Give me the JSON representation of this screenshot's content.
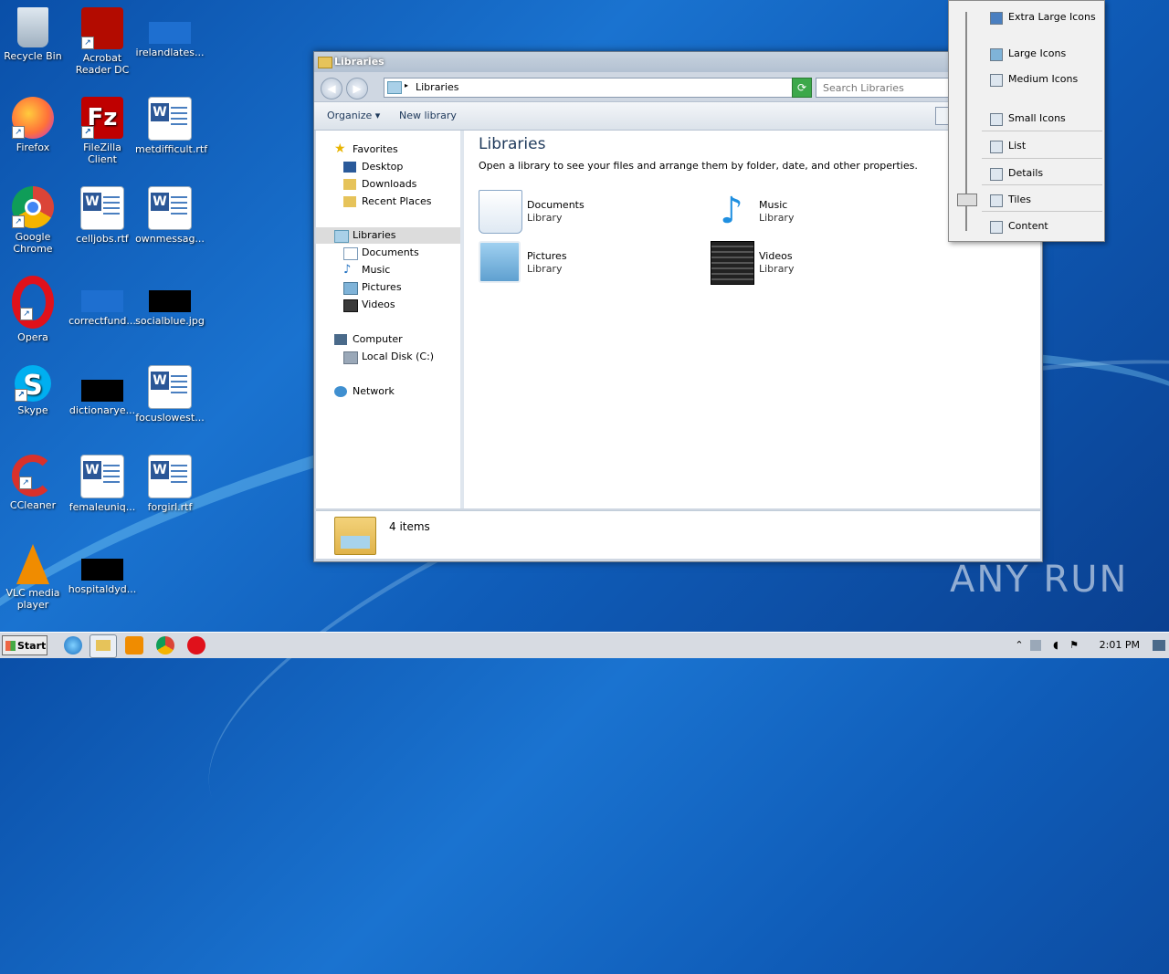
{
  "desktop": {
    "icons": [
      {
        "label": "Recycle Bin"
      },
      {
        "label": "Acrobat Reader DC"
      },
      {
        "label": "irelandlates..."
      },
      {
        "label": "Firefox"
      },
      {
        "label": "FileZilla Client"
      },
      {
        "label": "metdifficult.rtf"
      },
      {
        "label": "Google Chrome"
      },
      {
        "label": "celljobs.rtf"
      },
      {
        "label": "ownmessag..."
      },
      {
        "label": "Opera"
      },
      {
        "label": "correctfund..."
      },
      {
        "label": "socialblue.jpg"
      },
      {
        "label": "Skype"
      },
      {
        "label": "dictionarye..."
      },
      {
        "label": "focuslowest..."
      },
      {
        "label": "CCleaner"
      },
      {
        "label": "femaleuniq..."
      },
      {
        "label": "forgirl.rtf"
      },
      {
        "label": "VLC media player"
      },
      {
        "label": "hospitaldyd..."
      }
    ]
  },
  "window": {
    "title": "Libraries",
    "address": "Libraries",
    "search_placeholder": "Search Libraries",
    "toolbar": {
      "organize": "Organize",
      "new_library": "New library"
    },
    "nav": {
      "favorites": "Favorites",
      "desktop": "Desktop",
      "downloads": "Downloads",
      "recent": "Recent Places",
      "libraries": "Libraries",
      "documents": "Documents",
      "music": "Music",
      "pictures": "Pictures",
      "videos": "Videos",
      "computer": "Computer",
      "local_disk": "Local Disk (C:)",
      "network": "Network"
    },
    "content": {
      "heading": "Libraries",
      "subtitle": "Open a library to see your files and arrange them by folder, date, and other properties.",
      "libraries": [
        {
          "name": "Documents",
          "type": "Library"
        },
        {
          "name": "Music",
          "type": "Library"
        },
        {
          "name": "Pictures",
          "type": "Library"
        },
        {
          "name": "Videos",
          "type": "Library"
        }
      ]
    },
    "details": {
      "count": "4 items"
    }
  },
  "view_menu": {
    "items": [
      "Extra Large Icons",
      "Large Icons",
      "Medium Icons",
      "Small Icons",
      "List",
      "Details",
      "Tiles",
      "Content"
    ],
    "selected": "Tiles"
  },
  "taskbar": {
    "start": "Start",
    "clock": "2:01 PM"
  },
  "watermark": "ANY RUN"
}
